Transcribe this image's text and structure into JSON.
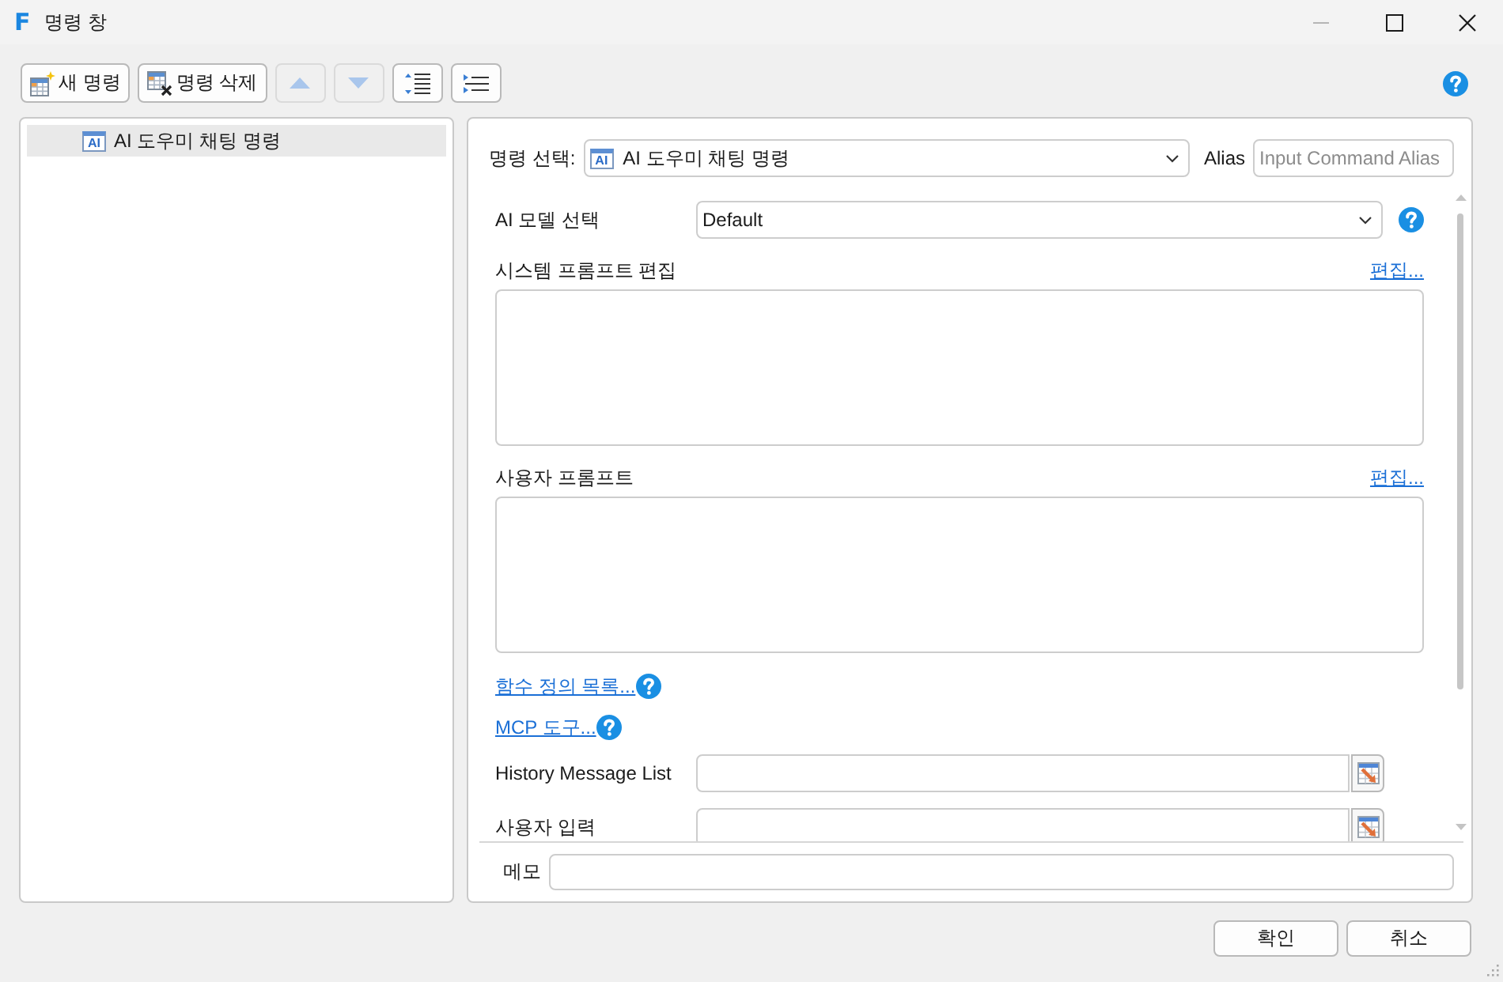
{
  "window": {
    "logo": "F",
    "title": "명령 창",
    "controls": [
      {
        "kind": "minimize",
        "disabled": true
      },
      {
        "kind": "maximize",
        "disabled": false
      },
      {
        "kind": "close",
        "disabled": false
      }
    ]
  },
  "toolbar": {
    "buttons": [
      {
        "kind": "new",
        "label": "새 명령",
        "disabled": false
      },
      {
        "kind": "delete",
        "label": "명령 삭제",
        "disabled": false
      },
      {
        "kind": "move_up",
        "disabled": true
      },
      {
        "kind": "move_down",
        "disabled": true
      },
      {
        "kind": "indent",
        "disabled": false
      },
      {
        "kind": "list",
        "disabled": false
      }
    ]
  },
  "command_tree": {
    "items": [
      {
        "icon_text": "AI",
        "label": "AI 도우미 채팅 명령",
        "selected": true
      }
    ]
  },
  "editor": {
    "command_select": {
      "label": "명령 선택:",
      "icon_text": "AI",
      "value": "AI 도우미 채팅 명령"
    },
    "alias": {
      "label": "Alias",
      "placeholder": "Input Command Alias"
    },
    "fields": [
      {
        "kind": "select",
        "label": "AI 모델 선택",
        "value": "Default",
        "help": true
      },
      {
        "kind": "textarea",
        "label": "시스템 프롬프트 편집",
        "link": "편집..."
      },
      {
        "kind": "textarea",
        "label": "사용자 프롬프트",
        "link": "편집..."
      },
      {
        "kind": "link",
        "label": "함수 정의 목록...",
        "help": true
      },
      {
        "kind": "link",
        "label": "MCP 도구...",
        "help": true
      },
      {
        "kind": "picker",
        "label": "History Message List"
      },
      {
        "kind": "picker",
        "label": "사용자 입력"
      }
    ],
    "memo": {
      "label": "메모"
    }
  },
  "buttons": [
    {
      "label": "확인"
    },
    {
      "label": "취소"
    }
  ]
}
